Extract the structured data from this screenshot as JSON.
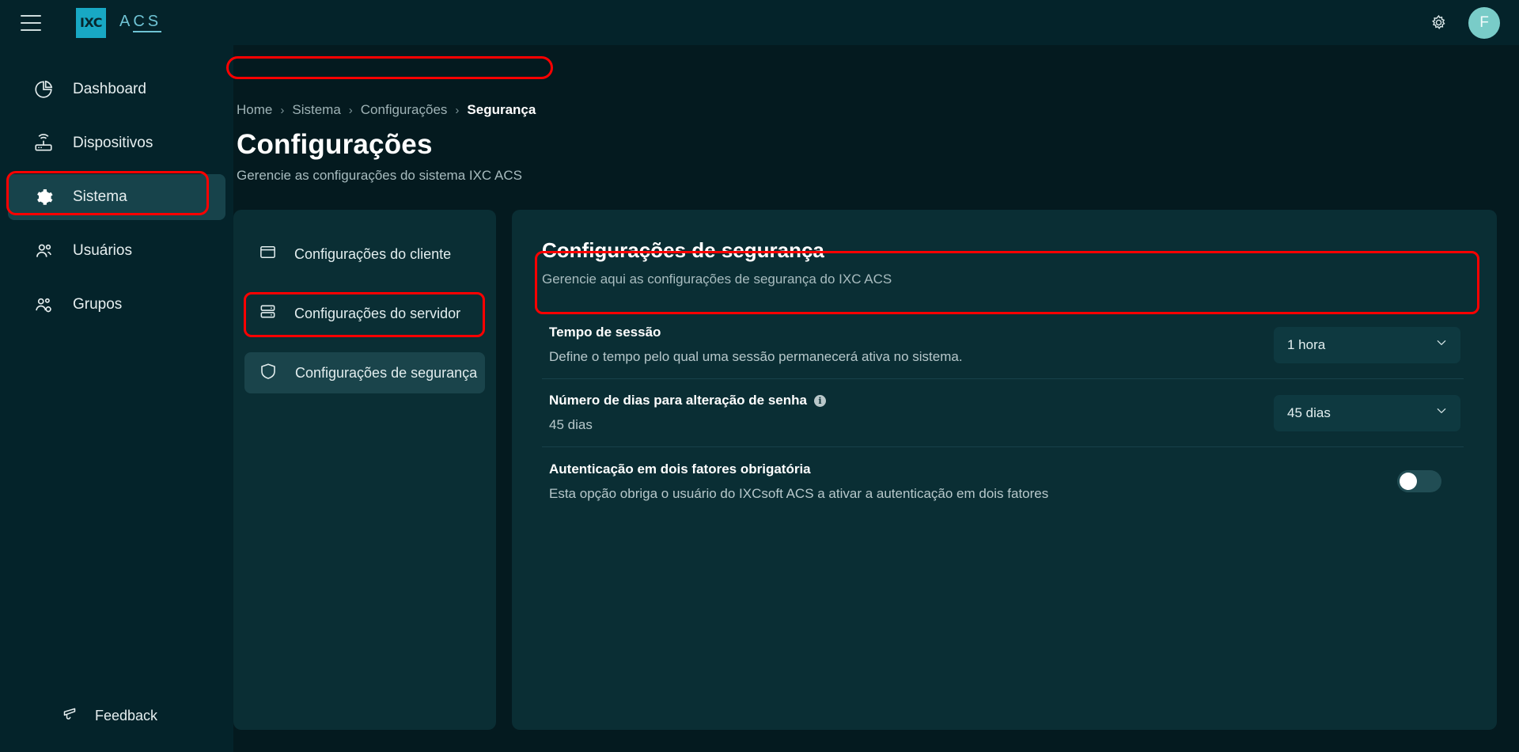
{
  "topbar": {
    "menu_icon": "hamburger-icon",
    "logo_text": "IXC",
    "brand_prefix": "A",
    "brand_suffix": "CS",
    "settings_icon": "gear-icon",
    "avatar_initial": "F"
  },
  "sidebar": {
    "items": [
      {
        "label": "Dashboard",
        "icon": "chart-pie-icon",
        "active": false
      },
      {
        "label": "Dispositivos",
        "icon": "router-icon",
        "active": false
      },
      {
        "label": "Sistema",
        "icon": "gear-icon",
        "active": true
      },
      {
        "label": "Usuários",
        "icon": "users-icon",
        "active": false
      },
      {
        "label": "Grupos",
        "icon": "users-gear-icon",
        "active": false
      }
    ],
    "feedback": {
      "label": "Feedback",
      "icon": "megaphone-icon"
    }
  },
  "breadcrumb": {
    "items": [
      "Home",
      "Sistema",
      "Configurações",
      "Segurança"
    ],
    "separator": "›",
    "current_index": 3
  },
  "page": {
    "title": "Configurações",
    "subtitle": "Gerencie as configurações do sistema IXC ACS"
  },
  "submenu": {
    "items": [
      {
        "label": "Configurações do cliente",
        "icon": "window-icon",
        "active": false
      },
      {
        "label": "Configurações do servidor",
        "icon": "server-icon",
        "active": false
      },
      {
        "label": "Configurações de segurança",
        "icon": "shield-icon",
        "active": true
      }
    ]
  },
  "content": {
    "title": "Configurações de segurança",
    "subtitle": "Gerencie aqui as configurações de segurança do IXC ACS",
    "settings": [
      {
        "label": "Tempo de sessão",
        "description": "Define o tempo pelo qual uma sessão permanecerá ativa no sistema.",
        "control": "select",
        "value": "1 hora",
        "has_info": false
      },
      {
        "label": "Número de dias para alteração de senha",
        "description": "45 dias",
        "control": "select",
        "value": "45 dias",
        "has_info": true
      },
      {
        "label": "Autenticação em dois fatores obrigatória",
        "description": "Esta opção obriga o usuário do IXCsoft ACS a ativar a autenticação em dois fatores",
        "control": "toggle",
        "value": "off",
        "has_info": false
      }
    ]
  },
  "colors": {
    "page_background": "#041a1f",
    "panel_background": "#0a2e34",
    "topbar_background": "#04232a",
    "accent": "#18a8c4",
    "avatar": "#79ccc8",
    "annotation": "#ff0000",
    "active_nav": "#17434b"
  }
}
